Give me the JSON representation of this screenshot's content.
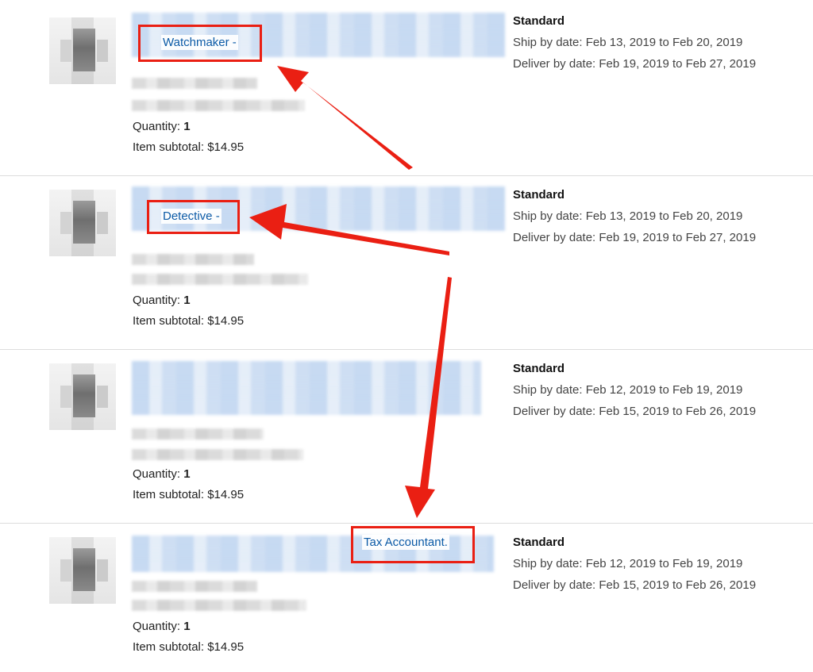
{
  "orders": [
    {
      "highlight_text": "Watchmaker -",
      "quantity_label": "Quantity:",
      "quantity_value": "1",
      "subtotal_label": "Item subtotal:",
      "subtotal_value": "$14.95",
      "shipping_speed": "Standard",
      "ship_by": "Ship by date: Feb 13, 2019 to Feb 20, 2019",
      "deliver_by": "Deliver by date: Feb 19, 2019 to Feb 27, 2019"
    },
    {
      "highlight_text": "Detective -",
      "quantity_label": "Quantity:",
      "quantity_value": "1",
      "subtotal_label": "Item subtotal:",
      "subtotal_value": "$14.95",
      "shipping_speed": "Standard",
      "ship_by": "Ship by date: Feb 13, 2019 to Feb 20, 2019",
      "deliver_by": "Deliver by date: Feb 19, 2019 to Feb 27, 2019"
    },
    {
      "highlight_text": "",
      "quantity_label": "Quantity:",
      "quantity_value": "1",
      "subtotal_label": "Item subtotal:",
      "subtotal_value": "$14.95",
      "shipping_speed": "Standard",
      "ship_by": "Ship by date: Feb 12, 2019 to Feb 19, 2019",
      "deliver_by": "Deliver by date: Feb 15, 2019 to Feb 26, 2019"
    },
    {
      "highlight_text": "Tax Accountant.",
      "quantity_label": "Quantity:",
      "quantity_value": "1",
      "subtotal_label": "Item subtotal:",
      "subtotal_value": "$14.95",
      "shipping_speed": "Standard",
      "ship_by": "Ship by date: Feb 12, 2019 to Feb 19, 2019",
      "deliver_by": "Deliver by date: Feb 15, 2019 to Feb 26, 2019"
    }
  ],
  "annotation": {
    "color": "#ea1f13",
    "icon": "red-arrow-icon"
  }
}
